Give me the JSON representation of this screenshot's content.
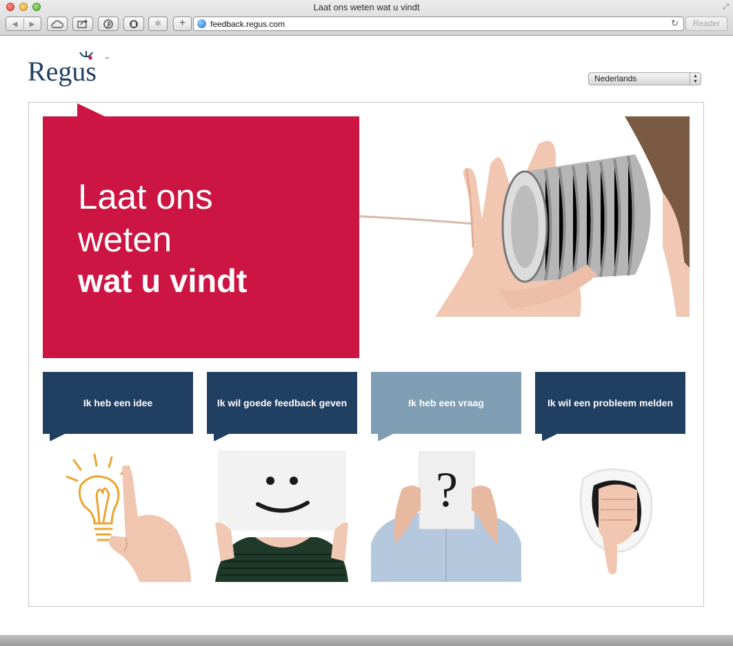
{
  "browser": {
    "window_title": "Laat ons weten wat u vindt",
    "url": "feedback.regus.com",
    "reader_label": "Reader",
    "new_tab_label": "+"
  },
  "site": {
    "logo_text": "Regus",
    "logo_tm": "™",
    "brand_color": "#213f61",
    "accent_color": "#cc1543"
  },
  "language": {
    "selected": "Nederlands"
  },
  "hero": {
    "line1": "Laat ons",
    "line2": "weten",
    "line3": "wat u vindt"
  },
  "cards": [
    {
      "label": "Ik heb een idee",
      "color": "#213f61",
      "image": "lightbulb-hand-photo"
    },
    {
      "label": "Ik wil goede feedback geven",
      "color": "#213f61",
      "image": "smiley-sign-photo"
    },
    {
      "label": "Ik heb een vraag",
      "color": "#7f9db3",
      "image": "question-mark-sign-photo"
    },
    {
      "label": "Ik wil een probleem melden",
      "color": "#213f61",
      "image": "thumbs-down-photo"
    }
  ]
}
